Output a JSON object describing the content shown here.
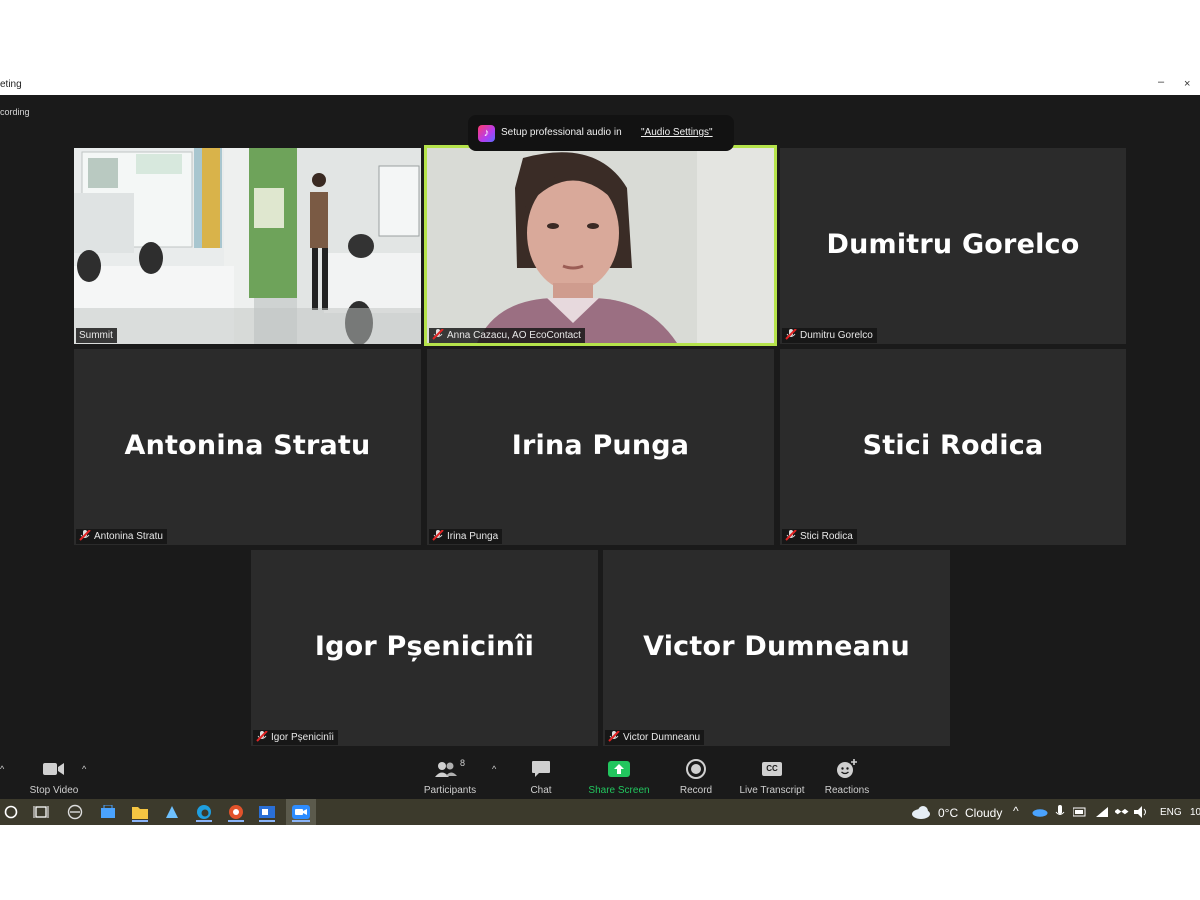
{
  "window": {
    "title": "eting",
    "minimize_glyph": "–",
    "close_glyph": "×"
  },
  "recording_label": "cording",
  "toast": {
    "message": "Setup professional audio in",
    "link": "\"Audio Settings\""
  },
  "tiles": [
    {
      "type": "video-room",
      "label": "Summit",
      "muted": false
    },
    {
      "type": "video-person",
      "label": "Anna Cazacu, AO EcoContact",
      "muted": true,
      "active_speaker": true,
      "highlight_color": "#b5e34b"
    },
    {
      "type": "name",
      "display_name": "Dumitru Gorelco",
      "label": "Dumitru Gorelco",
      "muted": true
    },
    {
      "type": "name",
      "display_name": "Antonina Stratu",
      "label": "Antonina Stratu",
      "muted": true
    },
    {
      "type": "name",
      "display_name": "Irina Punga",
      "label": "Irina Punga",
      "muted": true
    },
    {
      "type": "name",
      "display_name": "Stici Rodica",
      "label": "Stici Rodica",
      "muted": true
    },
    {
      "type": "name",
      "display_name": "Igor Pșenicinîi",
      "label": "Igor Pșenicinîi",
      "muted": true
    },
    {
      "type": "name",
      "display_name": "Victor Dumneanu",
      "label": "Victor Dumneanu",
      "muted": true
    }
  ],
  "controls": {
    "stop_video": "Stop Video",
    "participants": "Participants",
    "participants_count": "8",
    "chat": "Chat",
    "share_screen": "Share Screen",
    "record": "Record",
    "live_transcript": "Live Transcript",
    "cc_badge": "CC",
    "reactions": "Reactions",
    "share_color": "#22c55e"
  },
  "taskbar": {
    "weather_temp": "0°C",
    "weather_cond": "Cloudy",
    "language": "ENG",
    "clock_partial": "10"
  }
}
